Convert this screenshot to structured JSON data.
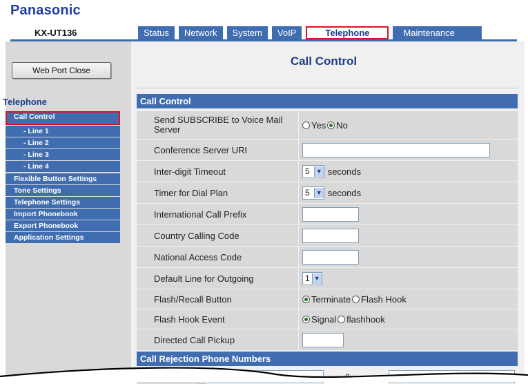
{
  "brand": "Panasonic",
  "model": "KX-UT136",
  "tabs": [
    {
      "label": "Status"
    },
    {
      "label": "Network"
    },
    {
      "label": "System"
    },
    {
      "label": "VoIP"
    },
    {
      "label": "Telephone",
      "active": true
    },
    {
      "label": "Maintenance"
    }
  ],
  "sidebar": {
    "web_port_button": "Web Port Close",
    "heading": "Telephone",
    "items": [
      {
        "label": "Call Control",
        "selected": true
      },
      {
        "label": "- Line 1"
      },
      {
        "label": "- Line 2"
      },
      {
        "label": "- Line 3"
      },
      {
        "label": "- Line 4"
      },
      {
        "label": "Flexible Button Settings"
      },
      {
        "label": "Tone Settings"
      },
      {
        "label": "Telephone Settings"
      },
      {
        "label": "Import Phonebook"
      },
      {
        "label": "Export Phonebook"
      },
      {
        "label": "Application Settings"
      }
    ]
  },
  "main": {
    "page_title": "Call Control",
    "section_call_control": "Call Control",
    "section_rejection": "Call Rejection Phone Numbers",
    "rows": {
      "subscribe_label": "Send SUBSCRIBE to Voice Mail Server",
      "subscribe_yes": "Yes",
      "subscribe_no": "No",
      "subscribe_value": "No",
      "conference_label": "Conference Server URI",
      "conference_value": "",
      "interdigit_label": "Inter-digit Timeout",
      "interdigit_value": "5",
      "interdigit_unit": "seconds",
      "dialplan_label": "Timer for Dial Plan",
      "dialplan_value": "5",
      "dialplan_unit": "seconds",
      "intl_prefix_label": "International Call Prefix",
      "intl_prefix_value": "",
      "country_code_label": "Country Calling Code",
      "country_code_value": "",
      "national_access_label": "National Access Code",
      "national_access_value": "",
      "default_line_label": "Default Line for Outgoing",
      "default_line_value": "1",
      "flash_recall_label": "Flash/Recall Button",
      "flash_recall_opt1": "Terminate",
      "flash_recall_opt2": "Flash Hook",
      "flash_recall_value": "Terminate",
      "flash_event_label": "Flash Hook Event",
      "flash_event_opt1": "Signal",
      "flash_event_opt2": "flashhook",
      "flash_event_value": "Signal",
      "pickup_label": "Directed Call Pickup",
      "pickup_value": ""
    },
    "rejection_second_number": "2."
  },
  "colors": {
    "accent_blue": "#3f6db0",
    "title_blue": "#1d3b88",
    "highlight_red": "#d8141c",
    "panel_grey": "#d9d9d9"
  }
}
